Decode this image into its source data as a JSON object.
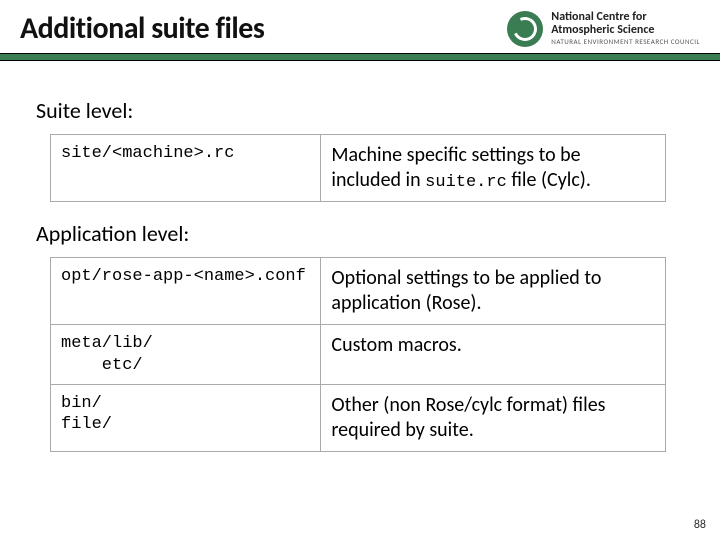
{
  "header": {
    "title": "Additional suite files",
    "org": {
      "line1": "National Centre for",
      "line2": "Atmospheric Science",
      "line3": "NATURAL ENVIRONMENT RESEARCH COUNCIL"
    }
  },
  "sections": {
    "suite_level_label": "Suite level:",
    "application_level_label": "Application level:"
  },
  "suite_table": [
    {
      "path": "site/<machine>.rc",
      "desc_pre": "Machine specific settings to be included in ",
      "desc_code": "suite.rc",
      "desc_post": " file (Cylc)."
    }
  ],
  "app_table": [
    {
      "path": "opt/rose-app-<name>.conf",
      "desc": "Optional settings to be applied to application (Rose)."
    },
    {
      "path": "meta/lib/\n    etc/",
      "desc": "Custom macros."
    },
    {
      "path": "bin/\nfile/",
      "desc": "Other (non Rose/cylc format) files required by suite."
    }
  ],
  "page_number": "88"
}
